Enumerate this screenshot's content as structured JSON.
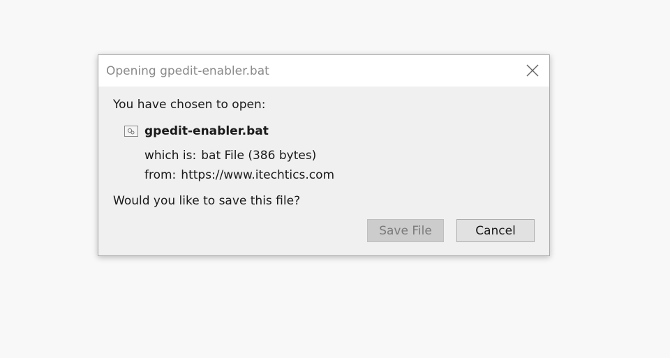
{
  "dialog": {
    "title": "Opening gpedit-enabler.bat",
    "chosen_text": "You have chosen to open:",
    "file": {
      "name": "gpedit-enabler.bat",
      "icon": "batch-file-icon",
      "which_is_label": "which is:",
      "which_is_value": "bat File (386 bytes)",
      "from_label": "from:",
      "from_value": "https://www.itechtics.com"
    },
    "question": "Would you like to save this file?",
    "buttons": {
      "save_label": "Save File",
      "save_disabled": true,
      "cancel_label": "Cancel"
    }
  }
}
